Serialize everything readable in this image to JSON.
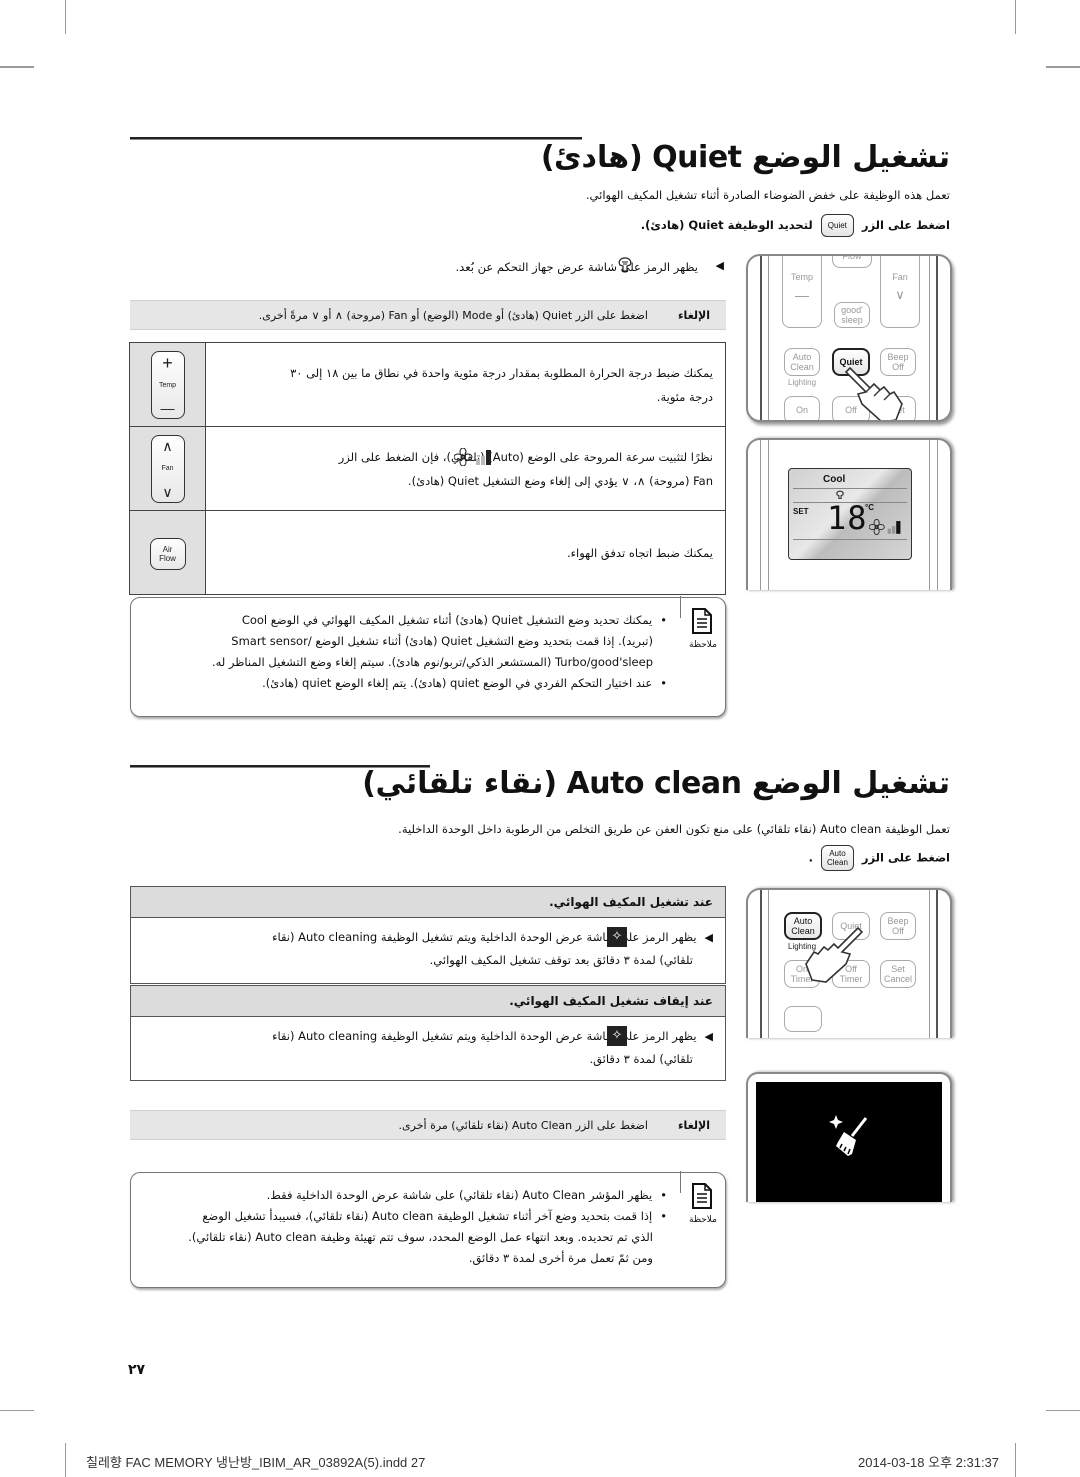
{
  "section1": {
    "title": "تشغيل الوضع Quiet (هادئ)",
    "intro": "تعمل هذه الوظيفة على خفض الضوضاء الصادرة أثناء تشغيل المكيف الهوائي.",
    "press_before": "اضغط على الزر",
    "press_button_label": "Quiet",
    "press_after": "لتحديد الوظيفة Quiet (هادئ).",
    "indicator_line": "يظهر الرمز على شاشة عرض جهاز التحكم عن بُعد.",
    "cancel": {
      "label": "الإلغاء",
      "text": "اضغط على الزر Quiet (هادئ) أو Mode (الوضع) أو Fan (مروحة) ∧ أو ∨ مرةً أخرى."
    },
    "table": [
      {
        "button_top": "+",
        "button_mid": "Temp",
        "button_bottom": "—",
        "line1": "يمكنك ضبط درجة الحرارة المطلوبة بمقدار درجة مئوية واحدة في نطاق ما بين ١٨ إلى ٣٠",
        "line2": "درجة مئوية."
      },
      {
        "button_top": "∧",
        "button_mid": "Fan",
        "button_bottom": "∨",
        "line1": "نظرًا لتثبيت سرعة المروحة على الوضع (Auto) (تلقائي)، فإن الضغط على الزر",
        "line2": "Fan (مروحة) ∧، ∨ يؤدي إلى إلغاء وضع التشغيل Quiet (هادئ)."
      },
      {
        "button_top": "Air",
        "button_mid": "Flow",
        "button_bottom": "",
        "line1": "يمكنك ضبط اتجاه تدفق الهواء.",
        "line2": ""
      }
    ],
    "note": {
      "label": "ملاحظة",
      "items": [
        {
          "line1": "يمكنك تحديد وضع التشغيل Quiet (هادئ) أثناء تشغيل المكيف الهوائي في الوضع Cool",
          "line2": "(تبريد). إذا قمت بتحديد وضع التشغيل Quiet (هادئ) أثناء تشغيل الوضع /Smart sensor",
          "line3": "Turbo/good'sleep (المستشعر الذكي/تربو/نوم هادئ). سيتم إلغاء وضع التشغيل المناظر له."
        },
        {
          "line1": "عند اختيار التحكم الفردي في الوضع quiet (هادئ). يتم إلغاء الوضع quiet (هادئ).",
          "line2": "",
          "line3": ""
        }
      ]
    },
    "remote": {
      "buttons": [
        "Temp",
        "Fan",
        "good'\nsleep",
        "Auto\nClean",
        "Quiet",
        "Beep\nOff",
        "On",
        "Off",
        "Set"
      ],
      "lighting_label": "Lighting",
      "flow_label": "Flow"
    },
    "lcd": {
      "mode": "Cool",
      "set_label": "SET",
      "temperature": "18",
      "unit": "°C"
    }
  },
  "section2": {
    "title": "تشغيل الوضع Auto clean (نقاء تلقائي)",
    "intro": "تعمل الوظيفة Auto clean (نقاء تلقائي) على منع تكون العفن عن طريق التخلص من الرطوبة داخل الوحدة الداخلية.",
    "press_before": "اضغط على الزر",
    "press_button_label": "Auto\nClean",
    "press_after": ".",
    "on_heading": "عند تشغيل المكيف الهوائي.",
    "on_line1": "يظهر الرمز على شاشة عرض الوحدة الداخلية ويتم تشغيل الوظيفة Auto cleaning (نقاء",
    "on_line2": "تلقائي) لمدة ٣ دقائق بعد توقف تشغيل المكيف الهوائي.",
    "off_heading": "عند إيقاف تشغيل المكيف الهوائي.",
    "off_line1": "يظهر الرمز على شاشة عرض الوحدة الداخلية ويتم تشغيل الوظيفة Auto cleaning (نقاء",
    "off_line2": "تلقائي) لمدة ٣ دقائق.",
    "cancel": {
      "label": "الإلغاء",
      "text": "اضغط على الزر Auto Clean (نقاء تلقائي) مرة أخرى."
    },
    "note": {
      "label": "ملاحظة",
      "items": [
        {
          "line1": "يظهر المؤشر Auto Clean (نقاء تلقائي) على شاشة عرض الوحدة الداخلية فقط.",
          "line2": "",
          "line3": "",
          "line4": ""
        },
        {
          "line1": "إذا قمت بتحديد وضع آخر أثناء تشغيل الوظيفة Auto clean (نقاء تلقائي)، فسيبدأ تشغيل الوضع",
          "line2": "الذي تم تحديده. وبعد انتهاء عمل الوضع المحدد، سوف تتم تهيئة وظيفة Auto clean (نقاء تلقائي).",
          "line3": "ومن ثمّ تعمل مرة أخرى لمدة ٣ دقائق.",
          "line4": ""
        }
      ]
    },
    "remote": {
      "buttons": [
        "Auto\nClean",
        "Quiet",
        "Beep\nOff",
        "On\nTimer",
        "Off\nTimer",
        "Set\nCancel"
      ],
      "lighting_label": "Lighting"
    }
  },
  "page_number": "٢٧",
  "footer": {
    "file": "칠레향 FAC MEMORY 냉난방_IBIM_AR_03892A(5).indd   27",
    "timestamp": "2014-03-18   오후 2:31:37"
  }
}
